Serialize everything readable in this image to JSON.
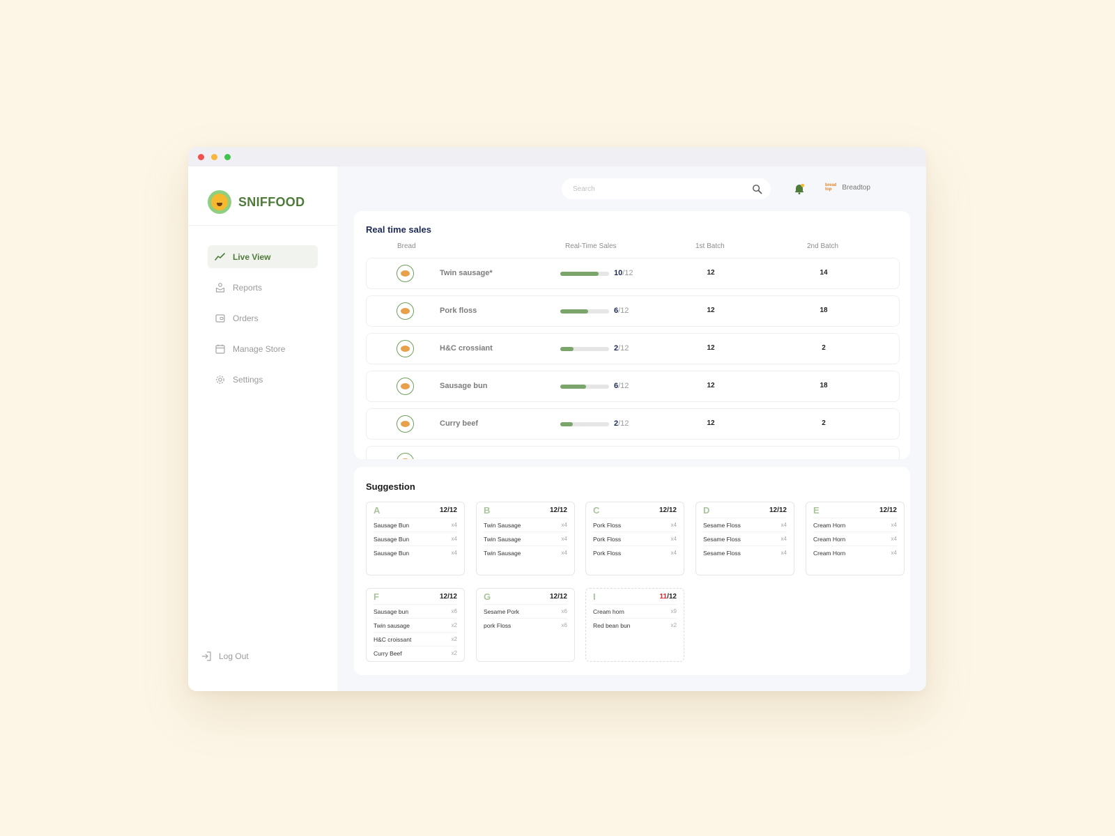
{
  "colors": {
    "accent": "#4e7a3a",
    "bar": "#7ba56b",
    "navy": "#1d2a57",
    "warning": "#e02020"
  },
  "app": {
    "brand": "SNIFFOOD"
  },
  "sidebar": {
    "items": [
      {
        "label": "Live View",
        "icon": "chart-line-icon",
        "active": true
      },
      {
        "label": "Reports",
        "icon": "reports-icon",
        "active": false
      },
      {
        "label": "Orders",
        "icon": "wallet-icon",
        "active": false
      },
      {
        "label": "Manage Store",
        "icon": "calendar-icon",
        "active": false
      },
      {
        "label": "Settings",
        "icon": "gear-icon",
        "active": false
      }
    ],
    "logout": "Log Out"
  },
  "header": {
    "search_placeholder": "Search",
    "store_logo_top": "bread",
    "store_logo_bottom": "top",
    "store_name": "Breadtop"
  },
  "sales": {
    "title": "Real time sales",
    "columns": {
      "bread": "Bread",
      "realtime": "Real-Time Sales",
      "batch1": "1st Batch",
      "batch2": "2nd Batch"
    },
    "rows": [
      {
        "name": "Twin sausage*",
        "sold": "10",
        "total": "/12",
        "progress": 0.79,
        "batch1": "12",
        "batch2": "14"
      },
      {
        "name": "Pork floss",
        "sold": "6",
        "total": "/12",
        "progress": 0.57,
        "batch1": "12",
        "batch2": "18"
      },
      {
        "name": "H&C crossiant",
        "sold": "2",
        "total": "/12",
        "progress": 0.27,
        "batch1": "12",
        "batch2": "2"
      },
      {
        "name": "Sausage bun",
        "sold": "6",
        "total": "/12",
        "progress": 0.53,
        "batch1": "12",
        "batch2": "18"
      },
      {
        "name": "Curry beef",
        "sold": "2",
        "total": "/12",
        "progress": 0.26,
        "batch1": "12",
        "batch2": "2"
      }
    ]
  },
  "suggestion": {
    "title": "Suggestion",
    "cards": [
      {
        "letter": "A",
        "count": "12",
        "total": "/12",
        "items": [
          {
            "name": "Sausage Bun",
            "qty": "x4"
          },
          {
            "name": "Sausage Bun",
            "qty": "x4"
          },
          {
            "name": "Sausage Bun",
            "qty": "x4"
          }
        ]
      },
      {
        "letter": "B",
        "count": "12",
        "total": "/12",
        "items": [
          {
            "name": "Twin Sausage",
            "qty": "x4"
          },
          {
            "name": "Twin Sausage",
            "qty": "x4"
          },
          {
            "name": "Twin Sausage",
            "qty": "x4"
          }
        ]
      },
      {
        "letter": "C",
        "count": "12",
        "total": "/12",
        "items": [
          {
            "name": "Pork Floss",
            "qty": "x4"
          },
          {
            "name": "Pork Floss",
            "qty": "x4"
          },
          {
            "name": "Pork Floss",
            "qty": "x4"
          }
        ]
      },
      {
        "letter": "D",
        "count": "12",
        "total": "/12",
        "items": [
          {
            "name": "Sesame Floss",
            "qty": "x4"
          },
          {
            "name": "Sesame Floss",
            "qty": "x4"
          },
          {
            "name": "Sesame Floss",
            "qty": "x4"
          }
        ]
      },
      {
        "letter": "E",
        "count": "12",
        "total": "/12",
        "items": [
          {
            "name": "Cream Horn",
            "qty": "x4"
          },
          {
            "name": "Cream Horn",
            "qty": "x4"
          },
          {
            "name": "Cream Horn",
            "qty": "x4"
          }
        ]
      },
      {
        "letter": "F",
        "count": "12",
        "total": "/12",
        "items": [
          {
            "name": "Sausage bun",
            "qty": "x6"
          },
          {
            "name": "Twin sausage",
            "qty": "x2"
          },
          {
            "name": "H&C croissant",
            "qty": "x2"
          },
          {
            "name": "Curry Beef",
            "qty": "x2"
          }
        ]
      },
      {
        "letter": "G",
        "count": "12",
        "total": "/12",
        "items": [
          {
            "name": "Sesame Pork",
            "qty": "x6"
          },
          {
            "name": "pork Floss",
            "qty": "x6"
          }
        ]
      },
      {
        "letter": "I",
        "count": "11",
        "total": "/12",
        "warning": true,
        "items": [
          {
            "name": "Cream horn",
            "qty": "x9"
          },
          {
            "name": "Red bean bun",
            "qty": "x2"
          }
        ]
      }
    ]
  }
}
